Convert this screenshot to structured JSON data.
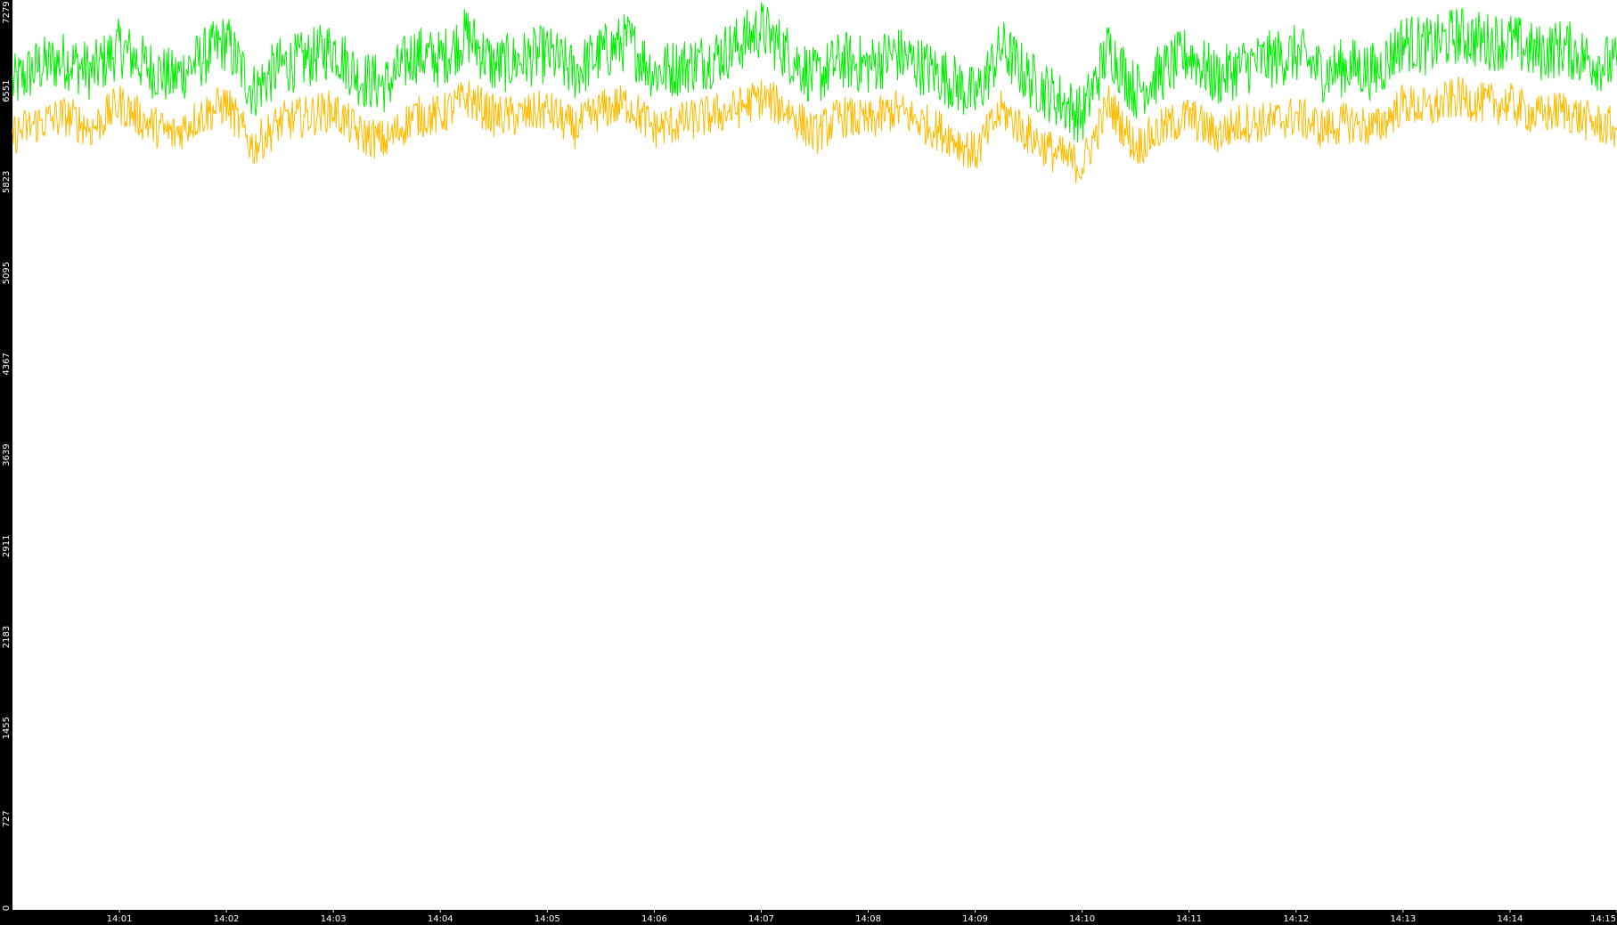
{
  "colors": {
    "frame": "#000000",
    "plot_background": "#ffffff",
    "tick_text": "#ffffff",
    "series_green": "#00ee00",
    "series_orange": "#ffbb00"
  },
  "chart_data": {
    "type": "line",
    "title": "",
    "xlabel": "",
    "ylabel": "",
    "grid": false,
    "legend": "none",
    "ylim": [
      0,
      7279
    ],
    "y_ticks": [
      0,
      727,
      1455,
      2183,
      2911,
      3639,
      4367,
      5095,
      5823,
      6551,
      7279
    ],
    "y_tick_labels": [
      "0",
      "727",
      "1455",
      "2183",
      "2911",
      "3639",
      "4367",
      "5095",
      "5823",
      "6551",
      "7279"
    ],
    "x_tick_labels": [
      "14:01",
      "14:02",
      "14:03",
      "14:04",
      "14:05",
      "14:06",
      "14:07",
      "14:08",
      "14:09",
      "14:10",
      "14:11",
      "14:12",
      "14:13",
      "14:14",
      "14:15"
    ],
    "x_unit": "minutes after 14:00",
    "xlim": [
      0.0,
      15.0
    ],
    "series": [
      {
        "color": "#00ee00",
        "x": [
          0.0,
          0.25,
          0.5,
          0.75,
          1.0,
          1.25,
          1.5,
          1.75,
          2.0,
          2.25,
          2.5,
          2.75,
          3.0,
          3.25,
          3.5,
          3.75,
          4.0,
          4.25,
          4.5,
          4.75,
          5.0,
          5.25,
          5.5,
          5.75,
          6.0,
          6.25,
          6.5,
          6.75,
          7.0,
          7.25,
          7.5,
          7.75,
          8.0,
          8.25,
          8.5,
          8.75,
          9.0,
          9.25,
          9.5,
          9.75,
          10.0,
          10.25,
          10.5,
          10.75,
          11.0,
          11.25,
          11.5,
          11.75,
          12.0,
          12.25,
          12.5,
          12.75,
          13.0,
          13.25,
          13.5,
          13.75,
          14.0,
          14.25,
          14.5,
          14.75,
          15.0
        ],
        "y": [
          6600,
          6750,
          6800,
          6700,
          6900,
          6750,
          6650,
          6800,
          6950,
          6550,
          6750,
          6800,
          6900,
          6650,
          6600,
          6850,
          6800,
          7000,
          6750,
          6800,
          6850,
          6700,
          6850,
          6950,
          6700,
          6750,
          6800,
          6900,
          7050,
          6850,
          6650,
          6800,
          6750,
          6850,
          6750,
          6650,
          6500,
          6900,
          6650,
          6500,
          6350,
          6900,
          6550,
          6700,
          6850,
          6650,
          6750,
          6800,
          6850,
          6700,
          6750,
          6700,
          6950,
          6900,
          7000,
          6950,
          6950,
          6850,
          6900,
          6800,
          6750
        ]
      },
      {
        "color": "#ffbb00",
        "x": [
          0.0,
          0.25,
          0.5,
          0.75,
          1.0,
          1.25,
          1.5,
          1.75,
          2.0,
          2.25,
          2.5,
          2.75,
          3.0,
          3.25,
          3.5,
          3.75,
          4.0,
          4.25,
          4.5,
          4.75,
          5.0,
          5.25,
          5.5,
          5.75,
          6.0,
          6.25,
          6.5,
          6.75,
          7.0,
          7.25,
          7.5,
          7.75,
          8.0,
          8.25,
          8.5,
          8.75,
          9.0,
          9.25,
          9.5,
          9.75,
          10.0,
          10.25,
          10.5,
          10.75,
          11.0,
          11.25,
          11.5,
          11.75,
          12.0,
          12.25,
          12.5,
          12.75,
          13.0,
          13.25,
          13.5,
          13.75,
          14.0,
          14.25,
          14.5,
          14.75,
          15.0
        ],
        "y": [
          6200,
          6300,
          6350,
          6250,
          6450,
          6300,
          6200,
          6350,
          6450,
          6100,
          6300,
          6350,
          6400,
          6200,
          6150,
          6350,
          6350,
          6500,
          6350,
          6350,
          6400,
          6250,
          6400,
          6450,
          6250,
          6300,
          6350,
          6400,
          6500,
          6400,
          6200,
          6350,
          6300,
          6400,
          6300,
          6200,
          6050,
          6400,
          6200,
          6050,
          5950,
          6450,
          6100,
          6250,
          6350,
          6200,
          6300,
          6300,
          6350,
          6250,
          6300,
          6250,
          6450,
          6400,
          6500,
          6450,
          6450,
          6350,
          6400,
          6300,
          6250
        ]
      }
    ]
  }
}
